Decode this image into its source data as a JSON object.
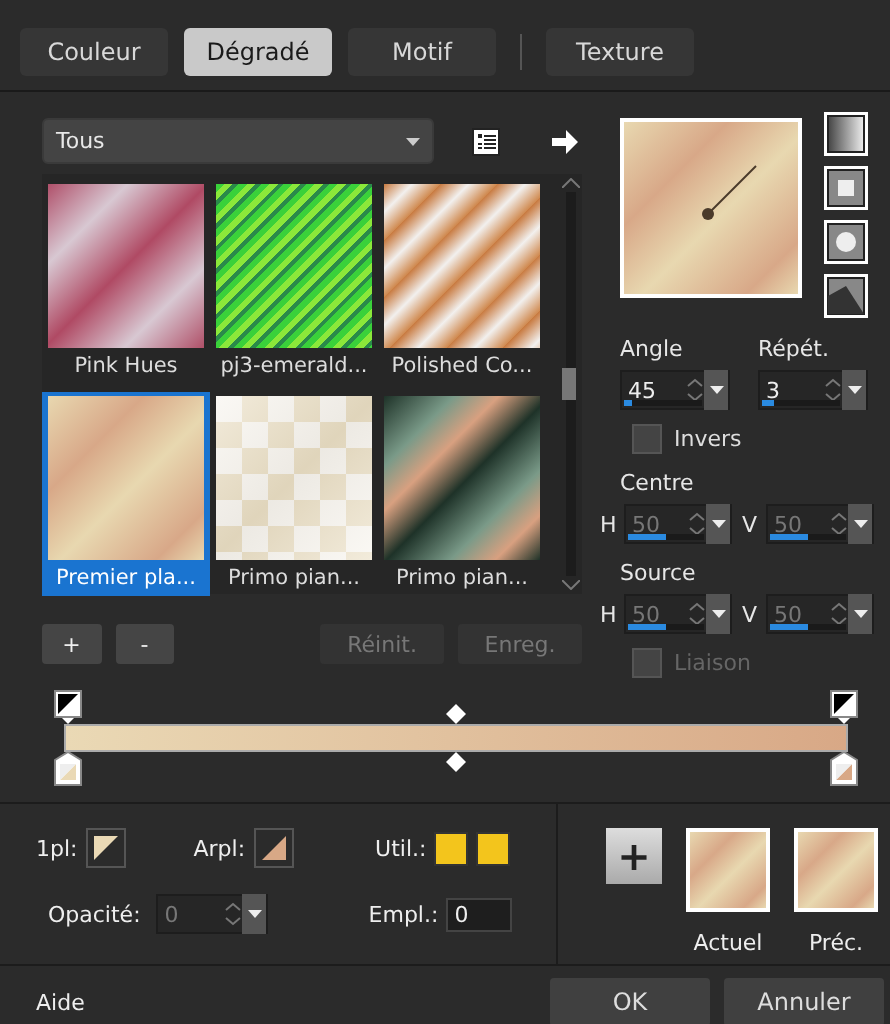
{
  "tabs": [
    {
      "label": "Couleur",
      "selected": false
    },
    {
      "label": "Dégradé",
      "selected": true
    },
    {
      "label": "Motif",
      "selected": false
    },
    {
      "label": "Texture",
      "selected": false
    }
  ],
  "category_dropdown": {
    "value": "Tous"
  },
  "gallery": [
    {
      "label": "Pink Hues",
      "kind": "pink",
      "selected": false
    },
    {
      "label": "pj3-emerald...",
      "kind": "stripes",
      "selected": false
    },
    {
      "label": "Polished Co...",
      "kind": "copper",
      "selected": false
    },
    {
      "label": "Premier pla...",
      "kind": "beige",
      "selected": true
    },
    {
      "label": "Primo pian...",
      "kind": "checker",
      "selected": false
    },
    {
      "label": "Primo pian...",
      "kind": "dark",
      "selected": false
    }
  ],
  "gallery_buttons": [
    {
      "label": "+",
      "disabled": false
    },
    {
      "label": "-",
      "disabled": false
    },
    {
      "label": "Réinit.",
      "disabled": true
    },
    {
      "label": "Enreg.",
      "disabled": true
    }
  ],
  "angle": {
    "label": "Angle",
    "value": "45",
    "level": 0.1,
    "disabled": false
  },
  "repeat": {
    "label": "Répét.",
    "value": "3",
    "level": 0.15,
    "disabled": false
  },
  "invert": {
    "label": "Invers",
    "checked": false,
    "disabled": false
  },
  "centre": {
    "label": "Centre",
    "fields": [
      {
        "label": "H",
        "value": "50",
        "level": 0.5,
        "disabled": true
      },
      {
        "label": "V",
        "value": "50",
        "level": 0.5,
        "disabled": true
      }
    ]
  },
  "source": {
    "label": "Source",
    "fields": [
      {
        "label": "H",
        "value": "50",
        "level": 0.5,
        "disabled": true
      },
      {
        "label": "V",
        "value": "50",
        "level": 0.5,
        "disabled": true
      }
    ]
  },
  "link": {
    "label": "Liaison",
    "checked": false,
    "disabled": true
  },
  "stop_panel": {
    "foreground_label": "1pl:",
    "background_label": "Arpl:",
    "use_label": "Util.:",
    "opacity": {
      "label": "Opacité:",
      "value": "0",
      "disabled": true
    },
    "location": {
      "label": "Empl.:",
      "value": "0"
    }
  },
  "add_button": "+",
  "previews": [
    {
      "label": "Actuel"
    },
    {
      "label": "Préc."
    }
  ],
  "footer": {
    "help": "Aide",
    "buttons": [
      "OK",
      "Annuler"
    ]
  }
}
